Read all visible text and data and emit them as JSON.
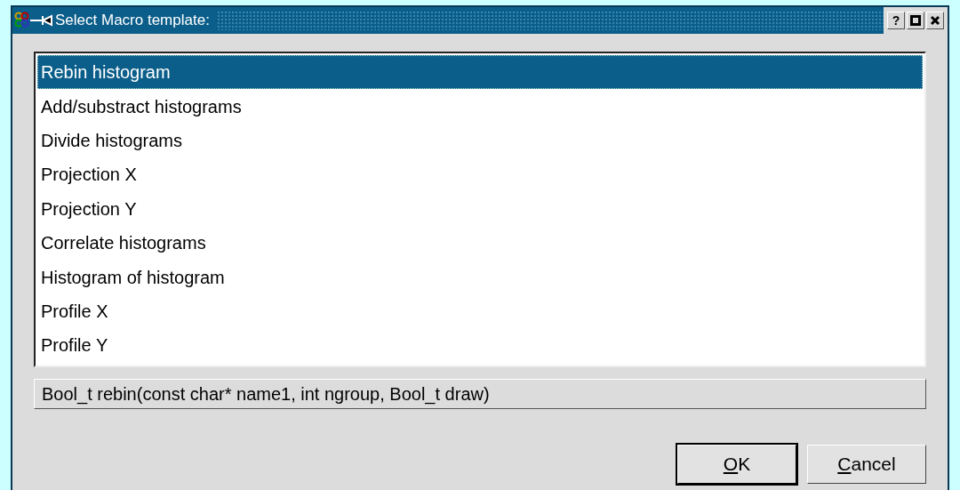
{
  "window": {
    "title": "Select Macro template:",
    "title_buttons": [
      {
        "kind": "help",
        "label": "?"
      },
      {
        "kind": "maximize"
      },
      {
        "kind": "close"
      }
    ]
  },
  "list": [
    {
      "label": "Rebin histogram",
      "selected": true
    },
    {
      "label": "Add/substract histograms",
      "selected": false
    },
    {
      "label": "Divide histograms",
      "selected": false
    },
    {
      "label": "Projection X",
      "selected": false
    },
    {
      "label": "Projection Y",
      "selected": false
    },
    {
      "label": "Correlate histograms",
      "selected": false
    },
    {
      "label": "Histogram of histogram",
      "selected": false
    },
    {
      "label": "Profile X",
      "selected": false
    },
    {
      "label": "Profile Y",
      "selected": false
    }
  ],
  "signature": "Bool_t rebin(const char* name1, int ngroup, Bool_t draw)",
  "buttons": [
    {
      "underlined_letter": "O",
      "rest_of_label": "K",
      "default": true
    },
    {
      "underlined_letter": "C",
      "rest_of_label": "ancel",
      "default": false
    }
  ]
}
